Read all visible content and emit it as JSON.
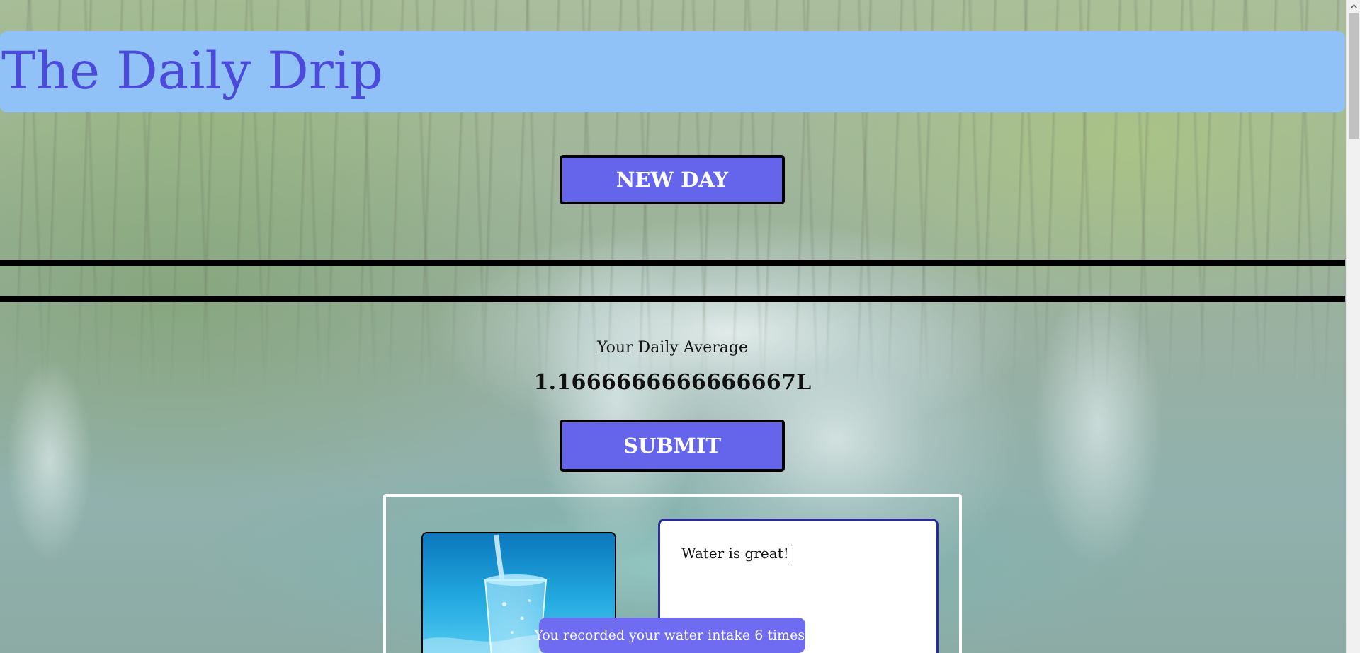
{
  "header": {
    "title": "The Daily Drip"
  },
  "controls": {
    "new_day_label": "NEW DAY",
    "submit_label": "SUBMIT"
  },
  "stats": {
    "average_label": "Your Daily Average",
    "average_value": "1.1666666666666667L"
  },
  "entry": {
    "note_text": "Water is great!"
  },
  "toast": {
    "message": "You recorded your water intake 6 times!"
  },
  "icons": {
    "scroll_up": "chevron-up-icon",
    "photo": "water-glass-image"
  },
  "colors": {
    "header_bg": "#90c2f8",
    "title": "#4b4adb",
    "button_bg": "#6565ec",
    "toast_bg": "#6f6cf2"
  }
}
